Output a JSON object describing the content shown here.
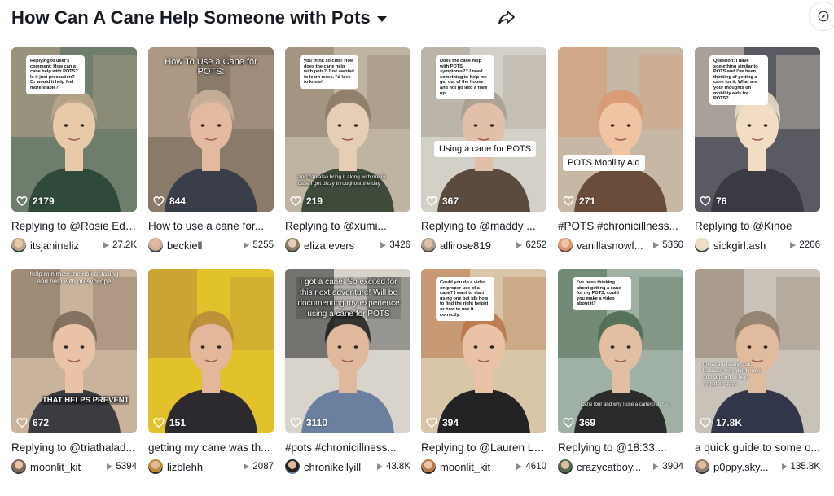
{
  "header": {
    "title": "How Can A Cane Help Someone with Pots",
    "share_icon": "share-arrow-icon",
    "corner_icon": "compass-icon"
  },
  "videos": [
    {
      "likes": "2179",
      "caption": "Replying to @Rosie Edg...",
      "author": "itsjanineliz",
      "views": "27.2K",
      "note": "Replying to user's comment: How can a cane help with POTS? Is it just precaution? Or would it help feel more stable?",
      "banner": "",
      "overlay": "",
      "palette": [
        "#6f7d6c",
        "#b9a58b",
        "#2f4a3a",
        "#e8c9a8"
      ]
    },
    {
      "likes": "844",
      "caption": "How to use a cane for...",
      "author": "beckiell",
      "views": "5255",
      "note": "",
      "banner": "",
      "overlay": "How To Use a Cane for POTS:",
      "palette": [
        "#8a7a6a",
        "#c9b09a",
        "#3a3d4a",
        "#e3b9a0"
      ]
    },
    {
      "likes": "219",
      "caption": "Replying to @xumi...",
      "author": "eliza.evers",
      "views": "3426",
      "note": "you think so cute! How does the cane help with pots? Just wanted to learn more, I'd love to know!",
      "banner": "",
      "overlay": "and can also bring it along with me in case I get dizzy throughout the day",
      "palette": [
        "#bfb4a2",
        "#8c7b66",
        "#3f4b3a",
        "#e6cdb6"
      ]
    },
    {
      "likes": "367",
      "caption": "Replying to @maddy ...",
      "author": "allirose819",
      "views": "6252",
      "note": "Does the cane help with POTS symptoms?? I need something to help me get out of the house and not go into a flare up",
      "banner": "Using a cane for POTS",
      "overlay": "",
      "palette": [
        "#d3d0c8",
        "#a89f90",
        "#5a4b3e",
        "#e2bfa8"
      ]
    },
    {
      "likes": "271",
      "caption": "#POTS #chronicillness...",
      "author": "vanillasnowf...",
      "views": "5360",
      "note": "",
      "banner": "POTS Mobility Aid",
      "overlay": "",
      "palette": [
        "#c7b7a5",
        "#d99a72",
        "#6a4c3a",
        "#f0c4a2"
      ]
    },
    {
      "likes": "76",
      "caption": "Replying to @Kinoe",
      "author": "sickgirl.ash",
      "views": "2206",
      "note": "Question: I have something similar to POTS and I've been thinking of getting a cane for it. What are your thoughts on mobility aids for POTS?",
      "banner": "",
      "overlay": "",
      "palette": [
        "#5a5a62",
        "#e8dcc6",
        "#3a3a42",
        "#f2dcc4"
      ]
    },
    {
      "likes": "672",
      "caption": "Replying to @triathalad...",
      "author": "moonlit_kit",
      "views": "5394",
      "note": "",
      "banner": "",
      "overlay": "THAT HELPS PREVENT",
      "overlay_top": "help minimize the risk of falling and help with presyncope",
      "palette": [
        "#c9b39c",
        "#7d6a5a",
        "#3b3c42",
        "#eac3a6"
      ]
    },
    {
      "likes": "151",
      "caption": "getting my cane was th...",
      "author": "lizblehh",
      "views": "2087",
      "note": "",
      "banner": "",
      "overlay": "",
      "palette": [
        "#e2c22a",
        "#b88c3a",
        "#2c2a2e",
        "#e5b79a"
      ]
    },
    {
      "likes": "3110",
      "caption": "#pots #chronicillness...",
      "author": "chronikellyill",
      "views": "43.8K",
      "note": "",
      "banner": "",
      "overlay": "I got a cane! So excited for this next adventure! Will be documenting my experience using a cane for POTS",
      "palette": [
        "#d8d4cc",
        "#222222",
        "#6b7f9e",
        "#e0b99c"
      ]
    },
    {
      "likes": "394",
      "caption": "Replying to @Lauren Le...",
      "author": "moonlit_kit",
      "views": "4610",
      "note": "Could you do a video on proper use of a cane? I want to start using one but idk how to find the right height or how to use it correctly.",
      "banner": "",
      "overlay": "",
      "palette": [
        "#d9c6a8",
        "#b8764a",
        "#232326",
        "#eac3a6"
      ]
    },
    {
      "likes": "369",
      "caption": "Replying to @18:33 ...",
      "author": "crazycatboy...",
      "views": "3904",
      "note": "I've been thinking about getting a cane for my POTS, could you make a video about it?",
      "banner": "",
      "overlay": "",
      "overlay_small": "Cane tour and why I use a cane/crutches",
      "palette": [
        "#9fb0a4",
        "#4f6b52",
        "#2b2b2b",
        "#e2bfa2"
      ]
    },
    {
      "likes": "17.8K",
      "caption": "a quick guide to some o...",
      "author": "p0ppy.sky...",
      "views": "135.8K",
      "note": "",
      "banner": "",
      "overlay": "",
      "overlay_small": "these are really good because they don't move and support to high symptom days",
      "palette": [
        "#c8c2b8",
        "#8f7e6c",
        "#32364a",
        "#e0bb9e"
      ]
    }
  ]
}
